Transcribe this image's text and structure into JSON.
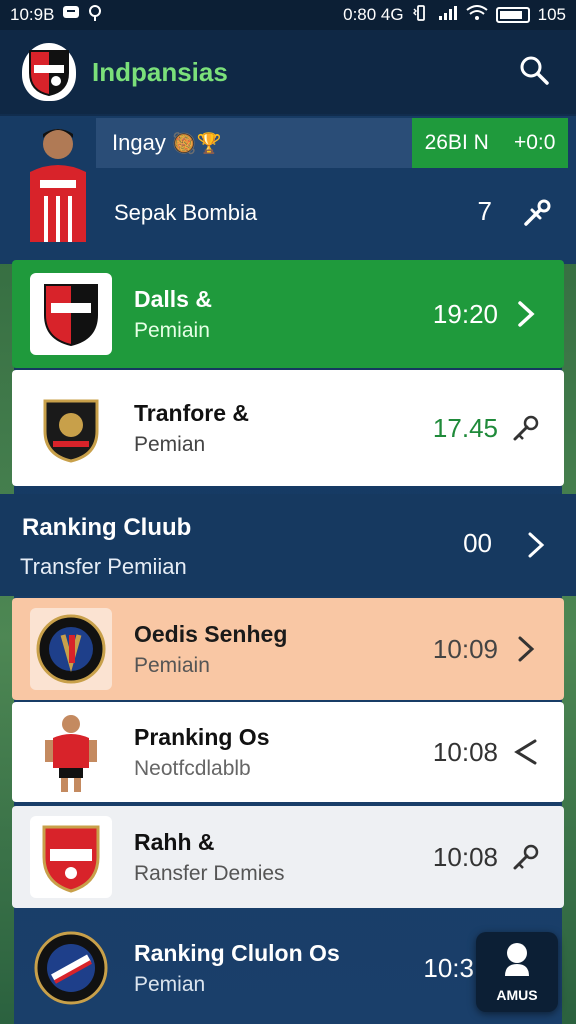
{
  "status_bar": {
    "time": "10:9B",
    "info": "0:80 4G",
    "battery": "105"
  },
  "app_bar": {
    "title": "Indpansias"
  },
  "banner": {
    "label": "Ingay",
    "emoji": "🥘🏆",
    "score_left": "26BI N",
    "score_right": "+0:0",
    "subtitle": "Sepak Bombia",
    "number": "7"
  },
  "cards": [
    {
      "title": "Dalls &",
      "subtitle": "Pemiain",
      "time": "19:20",
      "action": "chevron"
    },
    {
      "title": "Tranfore &",
      "subtitle": "Pemian",
      "time": "17.45",
      "action": "key"
    }
  ],
  "section": {
    "title": "Ranking Cluub",
    "subtitle": "Transfer Pemiian",
    "number": "00"
  },
  "list": [
    {
      "title": "Oedis Senheg",
      "subtitle": "Pemiain",
      "time": "10:09",
      "action": "chevron"
    },
    {
      "title": "Pranking Os",
      "subtitle": "Neotfcdlablb",
      "time": "10:08",
      "action": "share"
    },
    {
      "title": "Rahh &",
      "subtitle": "Ransfer Demies",
      "time": "10:08",
      "action": "key"
    },
    {
      "title": "Ranking Clulon Os",
      "subtitle": "Pemian",
      "time": "10:3",
      "action": "none"
    }
  ],
  "fab": {
    "label": "AMUS"
  },
  "colors": {
    "accent_green": "#1f9a3c",
    "title_green": "#7be07a",
    "navy": "#0f2845",
    "peach": "#f9c7a4"
  }
}
